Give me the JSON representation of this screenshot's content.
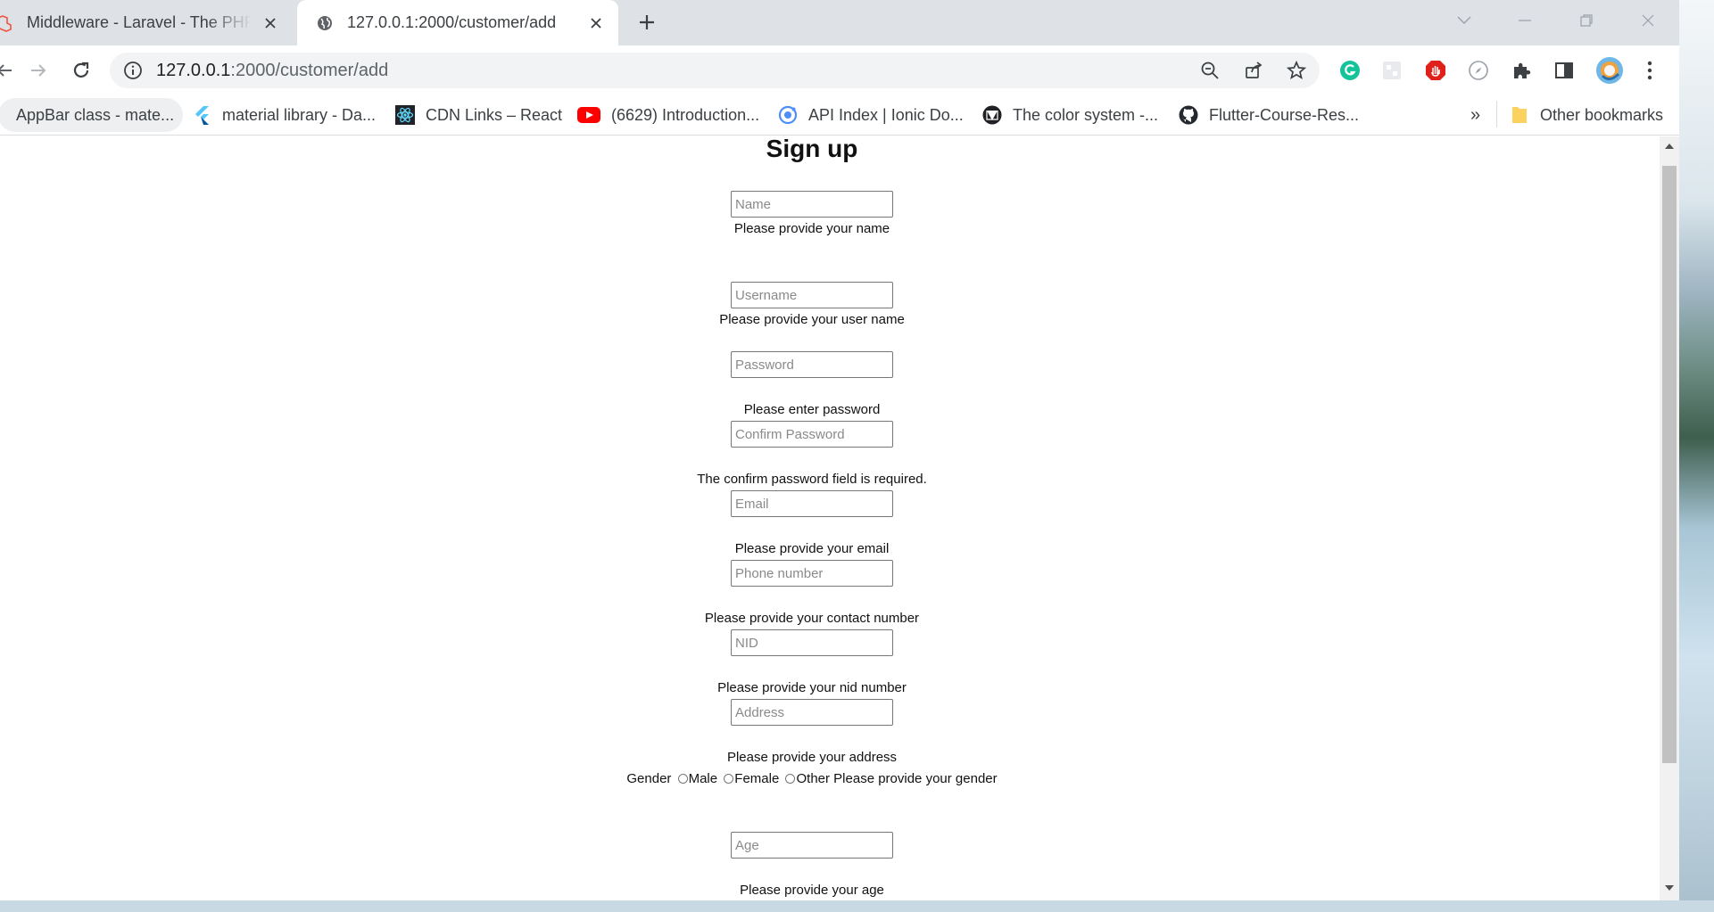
{
  "tabs": [
    {
      "title": "Middleware - Laravel - The PHP Framework For Web Artisans",
      "active": false,
      "icon": "laravel-icon"
    },
    {
      "title": "127.0.0.1:2000/customer/add",
      "active": true,
      "icon": "globe-icon"
    }
  ],
  "address": {
    "host": "127.0.0.1",
    "path": ":2000/customer/add"
  },
  "bookmarks": [
    {
      "label": "AppBar class - mate...",
      "icon": "flutter-icon"
    },
    {
      "label": "material library - Da...",
      "icon": "flutter-icon"
    },
    {
      "label": "CDN Links – React",
      "icon": "react-icon"
    },
    {
      "label": "(6629) Introduction...",
      "icon": "youtube-icon"
    },
    {
      "label": "API Index | Ionic Do...",
      "icon": "ionic-icon"
    },
    {
      "label": "The color system -...",
      "icon": "material-icon"
    },
    {
      "label": "Flutter-Course-Res...",
      "icon": "github-icon"
    }
  ],
  "bookmarks_more": "»",
  "other_bookmarks": "Other bookmarks",
  "form": {
    "heading": "Sign up",
    "name_placeholder": "Name",
    "name_msg": "Please provide your name",
    "username_placeholder": "Username",
    "username_msg": "Please provide your user name",
    "password_placeholder": "Password",
    "password_msg": "Please enter password",
    "confirm_placeholder": "Confirm Password",
    "confirm_msg": "The confirm password field is required.",
    "email_placeholder": "Email",
    "email_msg": "Please provide your email",
    "phone_placeholder": "Phone number",
    "phone_msg": "Please provide your contact number",
    "nid_placeholder": "NID",
    "nid_msg": "Please provide your nid number",
    "address_placeholder": "Address",
    "address_msg": "Please provide your address",
    "gender_label": "Gender",
    "gender_options": [
      "Male",
      "Female",
      "Other"
    ],
    "gender_msg": "Please provide your gender",
    "age_placeholder": "Age",
    "age_msg": "Please provide your age"
  },
  "colors": {
    "tabstrip": "#dee1e6",
    "omnibox": "#f1f3f4",
    "youtube": "#ff0000",
    "grammarly": "#15c39a",
    "adblock": "#e0201b"
  }
}
